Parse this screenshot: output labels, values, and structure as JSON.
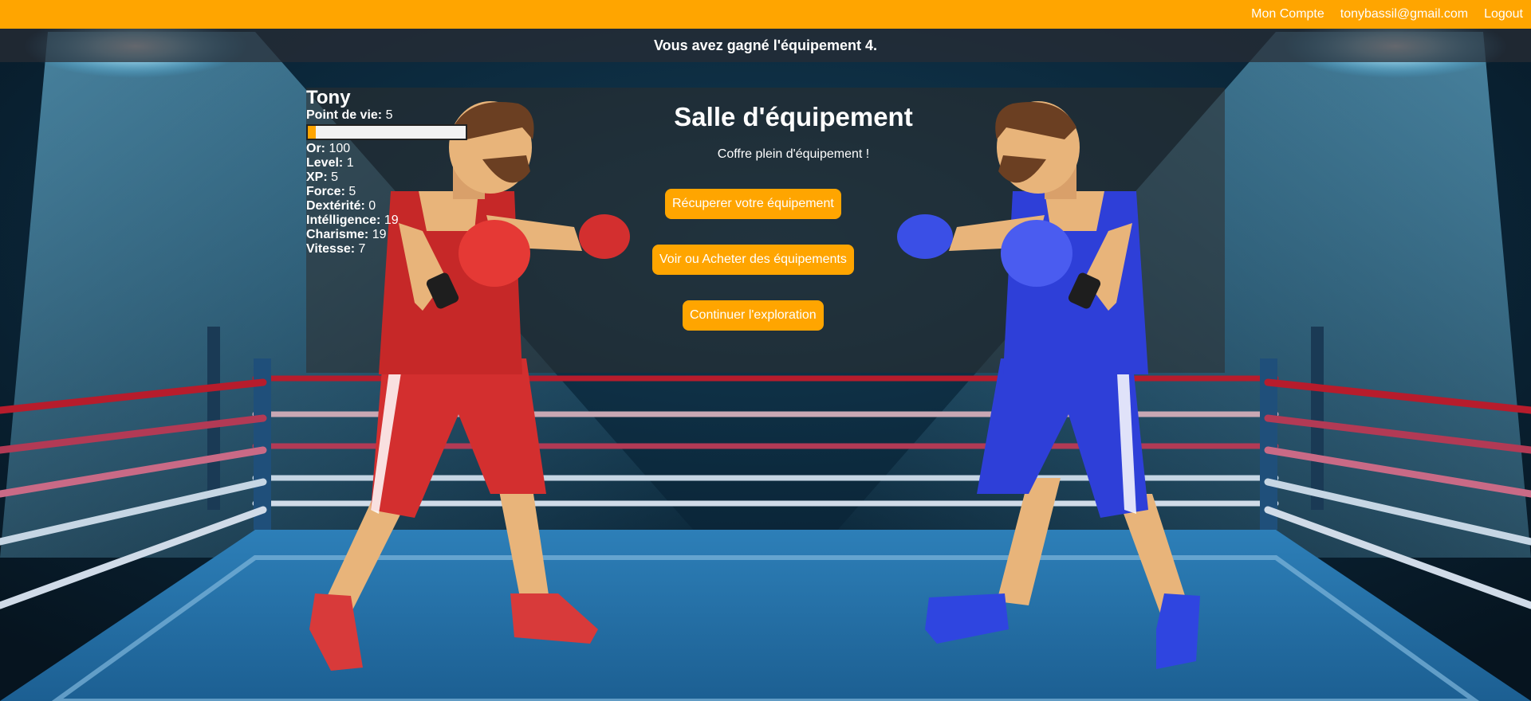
{
  "nav": {
    "account": "Mon Compte",
    "email": "tonybassil@gmail.com",
    "logout": "Logout"
  },
  "message": "Vous avez gagné l'équipement 4.",
  "player": {
    "name": "Tony",
    "hp_label": "Point de vie:",
    "hp_value": "5",
    "hp_fraction": 0.05,
    "stats": [
      {
        "label": "Or:",
        "value": "100"
      },
      {
        "label": "Level:",
        "value": "1"
      },
      {
        "label": "XP:",
        "value": "5"
      },
      {
        "label": "Force:",
        "value": "5"
      },
      {
        "label": "Dextérité:",
        "value": "0"
      },
      {
        "label": "Intélligence:",
        "value": "19"
      },
      {
        "label": "Charisme:",
        "value": "19"
      },
      {
        "label": "Vitesse:",
        "value": "7"
      }
    ]
  },
  "room": {
    "title": "Salle d'équipement",
    "subtitle": "Coffre plein d'équipement !"
  },
  "actions": {
    "retrieve": "Récuperer votre équipement",
    "shop": "Voir ou Acheter des équipements",
    "continue": "Continuer l'exploration"
  },
  "colors": {
    "accent": "#FFA500",
    "red_boxer": "#D32F2F",
    "blue_boxer": "#2E3FD8"
  }
}
